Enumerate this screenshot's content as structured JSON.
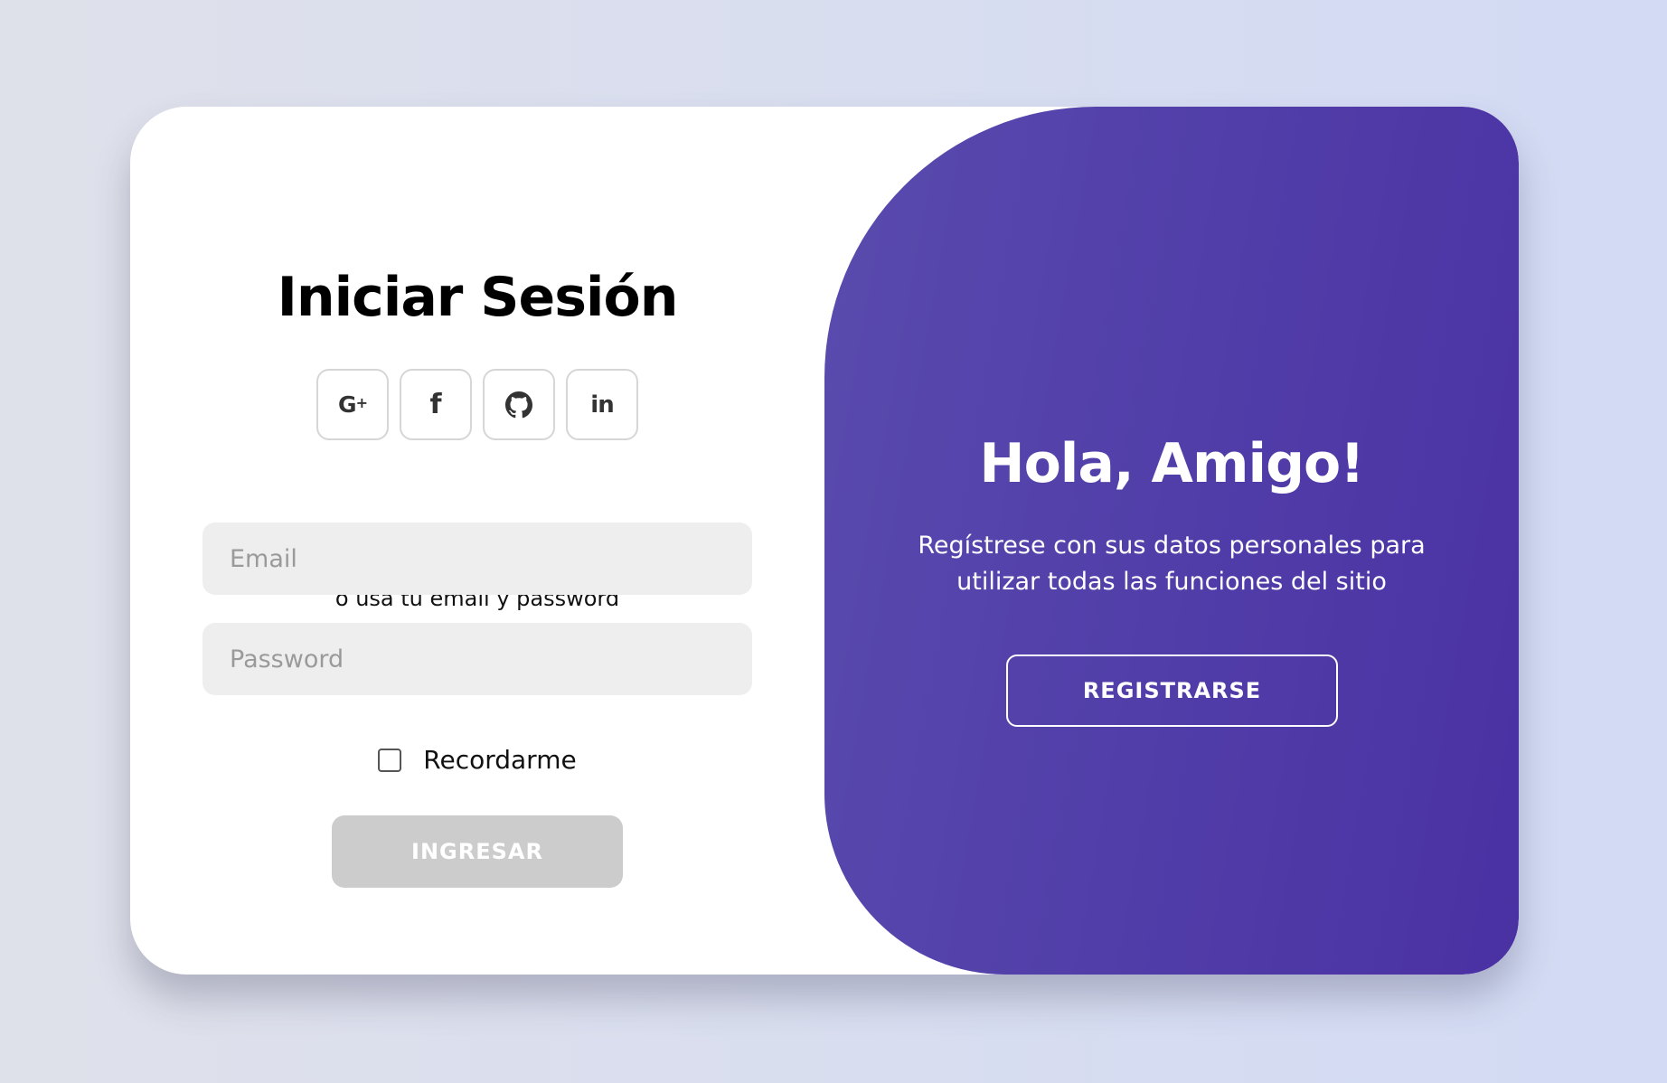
{
  "signin": {
    "title": "Iniciar Sesión",
    "social_buttons": [
      {
        "name": "google",
        "glyph": "G",
        "glyph_sup": "+",
        "icon": "google-plus-icon"
      },
      {
        "name": "facebook",
        "glyph": "f",
        "icon": "facebook-icon"
      },
      {
        "name": "github",
        "icon": "github-icon"
      },
      {
        "name": "linkedin",
        "glyph": "in",
        "icon": "linkedin-icon"
      }
    ],
    "alt_text": "o usa tu email y password",
    "email_placeholder": "Email",
    "email_value": "",
    "password_placeholder": "Password",
    "password_value": "",
    "remember_label": "Recordarme",
    "remember_checked": false,
    "submit_label": "INGRESAR"
  },
  "panel": {
    "title": "Hola, Amigo!",
    "text": "Regístrese con sus datos personales para utilizar todas las funciones del sitio",
    "register_label": "REGISTRARSE"
  },
  "colors": {
    "panel_gradient_start": "#594bae",
    "panel_gradient_end": "#4a31a3",
    "input_bg": "#eeeeee",
    "disabled_button": "#cccccc"
  }
}
